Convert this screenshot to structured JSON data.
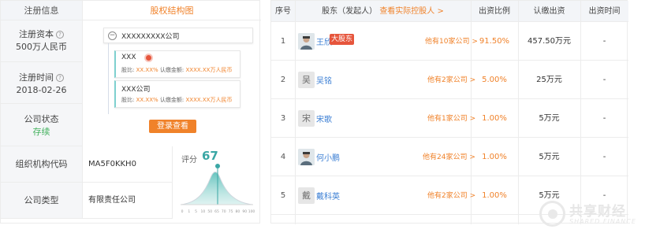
{
  "left": {
    "header": {
      "label": "注册信息",
      "title": "股权结构图"
    },
    "reg_capital": {
      "label": "注册资本",
      "value": "500万人民币"
    },
    "reg_time": {
      "label": "注册时间",
      "value": "2018-02-26"
    },
    "status": {
      "label": "公司状态",
      "value": "存续"
    },
    "org_code": {
      "label": "组织机构代码",
      "value": "MA5F0KKH0"
    },
    "company_type": {
      "label": "公司类型",
      "value": "有限责任公司"
    },
    "structure": {
      "root": "XXXXXXXXX公司",
      "nodes": [
        {
          "name": "XXX",
          "ratio_label": "股比:",
          "ratio": "XX.XX%",
          "amount_label": "认缴金额",
          "amount": "XXXX.XX万人民币"
        },
        {
          "name": "XXX公司",
          "ratio_label": "股比:",
          "ratio": "XX.XX%",
          "amount_label": "认缴金额",
          "amount": "XXXX.XX万人民币"
        }
      ],
      "login_button": "登录查看"
    },
    "score": {
      "label": "评分",
      "value": 67,
      "ticks": [
        "0",
        "1",
        "5",
        "10",
        "50",
        "65",
        "70",
        "75",
        "80",
        "90",
        "100"
      ]
    }
  },
  "table": {
    "headers": {
      "index": "序号",
      "holder": "股东（发起人）",
      "link": "查看实际控股人 >",
      "ratio": "出资比例",
      "amount": "认缴出资",
      "time": "出资时间"
    },
    "rows": [
      {
        "index": "1",
        "avatar": "",
        "has_photo": true,
        "name": "王欣",
        "badge": "大股东",
        "more": "他有10家公司 >",
        "ratio": "91.50%",
        "amount": "457.50万元",
        "time": "-"
      },
      {
        "index": "2",
        "avatar": "吴",
        "has_photo": false,
        "name": "吴铭",
        "badge": "",
        "more": "他有2家公司 >",
        "ratio": "5.00%",
        "amount": "25万元",
        "time": "-"
      },
      {
        "index": "3",
        "avatar": "宋",
        "has_photo": false,
        "name": "宋歌",
        "badge": "",
        "more": "他有1家公司 >",
        "ratio": "1.00%",
        "amount": "5万元",
        "time": "-"
      },
      {
        "index": "4",
        "avatar": "",
        "has_photo": true,
        "name": "何小鹏",
        "badge": "",
        "more": "他有24家公司 >",
        "ratio": "1.00%",
        "amount": "5万元",
        "time": "-"
      },
      {
        "index": "5",
        "avatar": "戴",
        "has_photo": false,
        "name": "戴科英",
        "badge": "",
        "more": "他有2家公司 >",
        "ratio": "1.00%",
        "amount": "5万元",
        "time": "-"
      }
    ]
  },
  "watermark": {
    "cn": "共享财经",
    "en": "SHARED FINANCE"
  },
  "colors": {
    "accent": "#f0822a",
    "link": "#3c7fd4",
    "badge": "#e6553c",
    "status": "#43b15e",
    "score": "#3aa7a5"
  }
}
